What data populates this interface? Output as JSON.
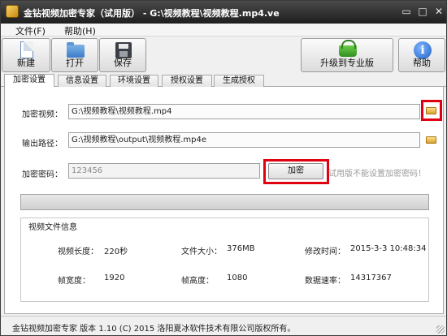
{
  "window": {
    "title": "金钻视频加密专家（试用版） - G:\\视频教程\\视频教程.mp4.ve",
    "controls": {
      "minimize": "▭",
      "maximize": "□",
      "close": "✕"
    }
  },
  "menu": {
    "file": "文件(F)",
    "help": "帮助(H)"
  },
  "toolbar": {
    "new_label": "新建",
    "open_label": "打开",
    "save_label": "保存",
    "upgrade_label": "升级到专业版",
    "help_label": "帮助",
    "help_glyph": "i"
  },
  "tabs": [
    "加密设置",
    "信息设置",
    "环境设置",
    "授权设置",
    "生成授权"
  ],
  "form": {
    "video_label": "加密视频：",
    "video_value": "G:\\视频教程\\视频教程.mp4",
    "output_label": "输出路径：",
    "output_value": "G:\\视频教程\\output\\视频教程.mp4e",
    "password_label": "加密密码：",
    "password_value": "123456",
    "encrypt_button": "加密",
    "hint": "试用版不能设置加密密码！"
  },
  "info": {
    "title": "视频文件信息",
    "duration_label": "视频长度：",
    "duration_value": "220秒",
    "size_label": "文件大小：",
    "size_value": "376MB",
    "modified_label": "修改时间：",
    "modified_value": "2015-3-3 10:48:34",
    "width_label": "帧宽度：",
    "width_value": "1920",
    "height_label": "帧高度：",
    "height_value": "1080",
    "rate_label": "数据速率：",
    "rate_value": "14317367"
  },
  "status": {
    "text": "金钻视频加密专家 版本 1.10 (C) 2015 洛阳夏冰软件技术有限公司版权所有。"
  },
  "colors": {
    "highlight": "#e0000f",
    "titlebar": "#2a2a2a"
  }
}
